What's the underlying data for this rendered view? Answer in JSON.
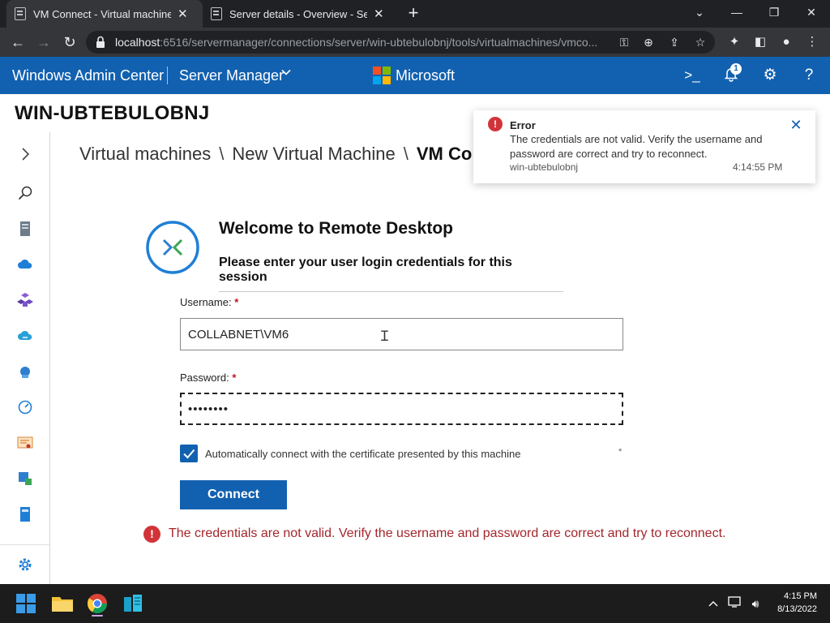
{
  "browser": {
    "tabs": [
      {
        "title": "VM Connect - Virtual machines -",
        "active": true
      },
      {
        "title": "Server details - Overview - Server",
        "active": false
      }
    ],
    "url_host": "localhost",
    "url_rest": ":6516/servermanager/connections/server/win-ubtebulobnj/tools/virtualmachines/vmco..."
  },
  "header": {
    "app_title": "Windows Admin Center",
    "tool_selector": "Server Manager",
    "brand": "Microsoft",
    "notification_count": "1",
    "accent_color": "#1261b0"
  },
  "server_name": "WIN-UBTEBULOBNJ",
  "breadcrumb": {
    "items": [
      "Virtual machines",
      "New Virtual Machine"
    ],
    "current": "VM Co",
    "separator": "\\"
  },
  "rail": {
    "icons": [
      "chevron-right-icon",
      "search-icon",
      "server-icon",
      "cloud-icon",
      "cubes-icon",
      "cloud-sync-icon",
      "network-icon",
      "gauge-icon",
      "certificate-icon",
      "devices-icon",
      "book-icon",
      "gear-icon"
    ]
  },
  "rdp": {
    "title": "Welcome to Remote Desktop",
    "subtitle": "Please enter your user login credentials for this session",
    "username_label": "Username:",
    "username_value": "COLLABNET\\VM6",
    "password_label": "Password:",
    "password_value": "••••••••",
    "required_marker": "*",
    "cert_label": "Automatically connect with the certificate presented by this machine",
    "cert_checked": true,
    "cert_asterisk": "*",
    "connect_label": "Connect",
    "error_message": "The credentials are not valid. Verify the username and password are correct and try to reconnect."
  },
  "toast": {
    "title": "Error",
    "message": "The credentials are not valid. Verify the username and password are correct and try to reconnect.",
    "source": "win-ubtebulobnj",
    "time": "4:14:55 PM",
    "status_color": "#d13438"
  },
  "taskbar": {
    "apps": [
      "windows-start-icon",
      "file-explorer-icon",
      "chrome-icon",
      "admin-center-icon"
    ],
    "clock_time": "4:15 PM",
    "clock_date": "8/13/2022"
  }
}
